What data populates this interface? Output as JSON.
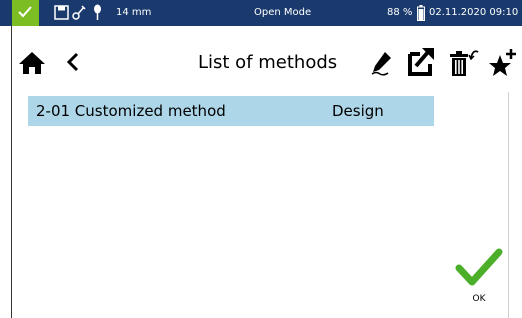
{
  "status_bar": {
    "size": "14 mm",
    "mode": "Open Mode",
    "battery": "88 %",
    "datetime": "02.11.2020 09:10",
    "icons": [
      "check-icon",
      "save-icon",
      "pipette-icon",
      "location-pin-icon",
      "battery-icon"
    ],
    "accent_color": "#7dbd24",
    "background_color": "#1a3a6e"
  },
  "toolbar": {
    "title": "List of methods",
    "icons": [
      "home-icon",
      "back-icon",
      "edit-icon",
      "export-icon",
      "delete-icon",
      "add-favorite-icon"
    ]
  },
  "methods": [
    {
      "name": "2-01 Customized method",
      "type": "Design"
    }
  ],
  "ok_button": {
    "label": "OK",
    "icon": "checkmark-icon",
    "color": "#4caf2a"
  },
  "colors": {
    "selected_row": "#add6e8"
  }
}
